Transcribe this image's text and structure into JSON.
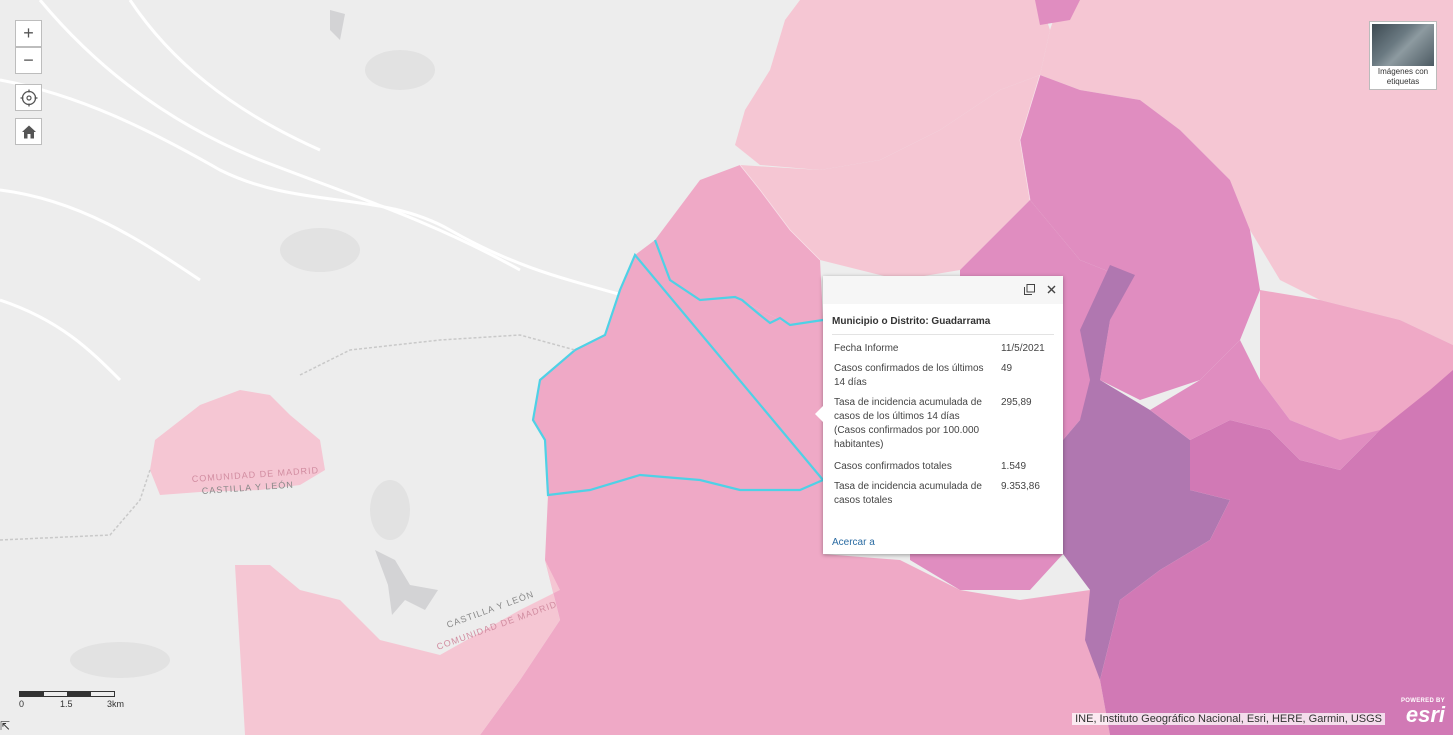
{
  "zoom_controls": {
    "zoom_in": "+",
    "zoom_out": "−"
  },
  "basemap": {
    "label": "Imágenes con etiquetas"
  },
  "map_labels": {
    "upper_left_madrid": "COMUNIDAD DE MADRID",
    "upper_left_cyl": "CASTILLA Y LEÓN",
    "lower_cyl": "CASTILLA Y LEÓN",
    "lower_madrid": "COMUNIDAD DE MADRID"
  },
  "popup": {
    "title": "Municipio o Distrito: Guadarrama",
    "fields": [
      {
        "label": "Fecha Informe",
        "value": "11/5/2021"
      },
      {
        "label": "Casos confirmados de los últimos 14 días",
        "value": "49"
      },
      {
        "label": "Tasa de incidencia acumulada de casos de los últimos 14 días (Casos confirmados por 100.000 habitantes)",
        "value": "295,89"
      },
      {
        "label": "Casos confirmados totales",
        "value": "1.549"
      },
      {
        "label": "Tasa de incidencia acumulada de casos totales",
        "value": "9.353,86"
      }
    ],
    "zoom_link": "Acercar a"
  },
  "scale": {
    "t0": "0",
    "t1": "1.5",
    "t2": "3km"
  },
  "attribution": "INE, Instituto Geográfico Nacional, Esri, HERE, Garmin, USGS",
  "esri": {
    "powered_by": "POWERED BY",
    "name": "esri"
  },
  "colors": {
    "basemap_gray": "#ededed",
    "light_pink": "#f5c6d3",
    "mid_pink": "#efa9c6",
    "strong_pink": "#e08dc0",
    "magenta": "#d179b5",
    "purple": "#b077b0",
    "selection": "#4fd1e6",
    "link": "#2b6ca3"
  }
}
